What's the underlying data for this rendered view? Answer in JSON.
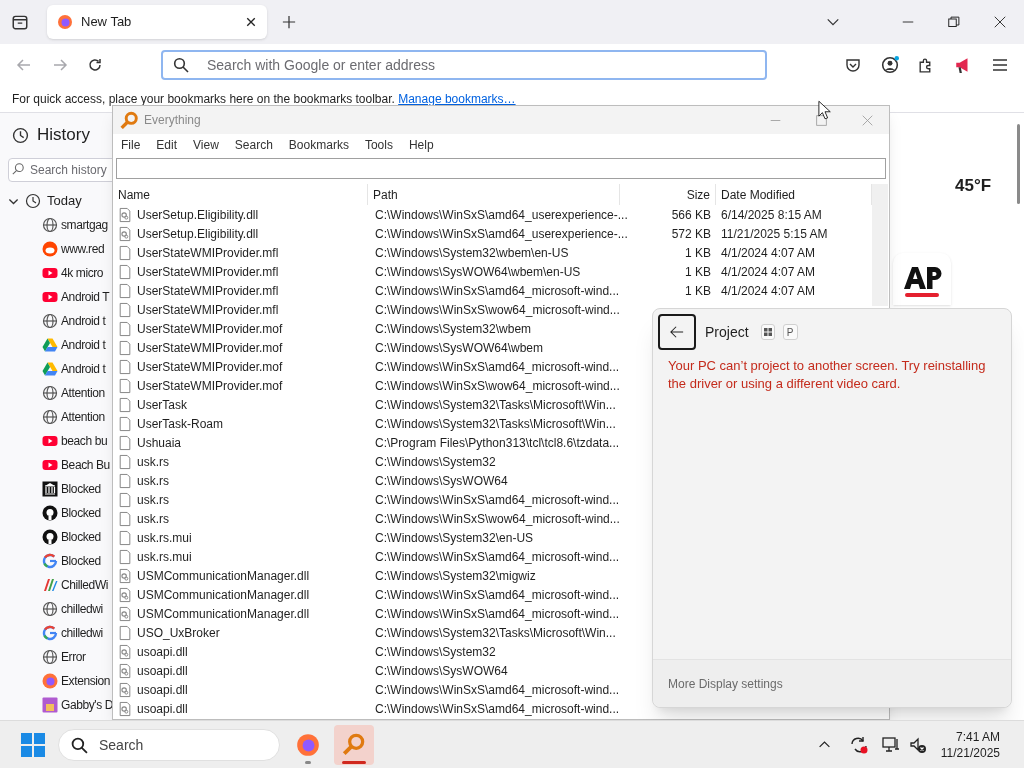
{
  "browser": {
    "tab": {
      "title": "New Tab",
      "selected": true
    },
    "back": {
      "disabled": true
    },
    "forward": {
      "disabled": true
    },
    "address_bar": {
      "placeholder": "Search with Google or enter address"
    },
    "bookmarks_bar": {
      "text": "For quick access, place your bookmarks here on the bookmarks toolbar.",
      "link": "Manage bookmarks…"
    }
  },
  "sidebar": {
    "title": "History",
    "search": {
      "placeholder": "Search history"
    },
    "groups": [
      {
        "label": "Today",
        "expanded": true,
        "children": [
          {
            "label": "smartgag",
            "kind": "globe"
          },
          {
            "label": "www.red",
            "kind": "reddit"
          },
          {
            "label": "4k micro",
            "kind": "youtube"
          },
          {
            "label": "Android T",
            "kind": "youtube"
          },
          {
            "label": "Android t",
            "kind": "globe"
          },
          {
            "label": "Android t",
            "kind": "drive"
          },
          {
            "label": "Android t",
            "kind": "drive"
          },
          {
            "label": "Attention",
            "kind": "globe"
          },
          {
            "label": "Attention",
            "kind": "globe"
          },
          {
            "label": "beach bu",
            "kind": "youtube"
          },
          {
            "label": "Beach Bu",
            "kind": "youtube"
          },
          {
            "label": "Blocked",
            "kind": "library"
          },
          {
            "label": "Blocked",
            "kind": "github"
          },
          {
            "label": "Blocked",
            "kind": "github"
          },
          {
            "label": "Blocked",
            "kind": "google"
          },
          {
            "label": "ChilledWi",
            "kind": "chilled"
          },
          {
            "label": "chilledwi",
            "kind": "globe"
          },
          {
            "label": "chilledwi",
            "kind": "google"
          },
          {
            "label": "Error",
            "kind": "globe"
          },
          {
            "label": "Extension",
            "kind": "firefox"
          },
          {
            "label": "Gabby's D",
            "kind": "square"
          }
        ]
      }
    ]
  },
  "new_tab": {
    "weather": "45°F"
  },
  "everything": {
    "title": "Everything",
    "menu": [
      "File",
      "Edit",
      "View",
      "Search",
      "Bookmarks",
      "Tools",
      "Help"
    ],
    "columns": [
      "Name",
      "Path",
      "Size",
      "Date Modified"
    ],
    "rows": [
      {
        "kind": "dll",
        "name": "UserSetup.Eligibility.dll",
        "path": "C:\\Windows\\WinSxS\\amd64_userexperience-...",
        "size": "566 KB",
        "date": "6/14/2025 8:15 AM"
      },
      {
        "kind": "dll",
        "name": "UserSetup.Eligibility.dll",
        "path": "C:\\Windows\\WinSxS\\amd64_userexperience-...",
        "size": "572 KB",
        "date": "11/21/2025 5:15 AM"
      },
      {
        "kind": "file",
        "name": "UserStateWMIProvider.mfl",
        "path": "C:\\Windows\\System32\\wbem\\en-US",
        "size": "1 KB",
        "date": "4/1/2024 4:07 AM"
      },
      {
        "kind": "file",
        "name": "UserStateWMIProvider.mfl",
        "path": "C:\\Windows\\SysWOW64\\wbem\\en-US",
        "size": "1 KB",
        "date": "4/1/2024 4:07 AM"
      },
      {
        "kind": "file",
        "name": "UserStateWMIProvider.mfl",
        "path": "C:\\Windows\\WinSxS\\amd64_microsoft-wind...",
        "size": "1 KB",
        "date": "4/1/2024 4:07 AM"
      },
      {
        "kind": "file",
        "name": "UserStateWMIProvider.mfl",
        "path": "C:\\Windows\\WinSxS\\wow64_microsoft-wind..."
      },
      {
        "kind": "file",
        "name": "UserStateWMIProvider.mof",
        "path": "C:\\Windows\\System32\\wbem"
      },
      {
        "kind": "file",
        "name": "UserStateWMIProvider.mof",
        "path": "C:\\Windows\\SysWOW64\\wbem"
      },
      {
        "kind": "file",
        "name": "UserStateWMIProvider.mof",
        "path": "C:\\Windows\\WinSxS\\amd64_microsoft-wind..."
      },
      {
        "kind": "file",
        "name": "UserStateWMIProvider.mof",
        "path": "C:\\Windows\\WinSxS\\wow64_microsoft-wind..."
      },
      {
        "kind": "file",
        "name": "UserTask",
        "path": "C:\\Windows\\System32\\Tasks\\Microsoft\\Win..."
      },
      {
        "kind": "file",
        "name": "UserTask-Roam",
        "path": "C:\\Windows\\System32\\Tasks\\Microsoft\\Win..."
      },
      {
        "kind": "file",
        "name": "Ushuaia",
        "path": "C:\\Program Files\\Python313\\tcl\\tcl8.6\\tzdata..."
      },
      {
        "kind": "file",
        "name": "usk.rs",
        "path": "C:\\Windows\\System32"
      },
      {
        "kind": "file",
        "name": "usk.rs",
        "path": "C:\\Windows\\SysWOW64"
      },
      {
        "kind": "file",
        "name": "usk.rs",
        "path": "C:\\Windows\\WinSxS\\amd64_microsoft-wind..."
      },
      {
        "kind": "file",
        "name": "usk.rs",
        "path": "C:\\Windows\\WinSxS\\wow64_microsoft-wind..."
      },
      {
        "kind": "file",
        "name": "usk.rs.mui",
        "path": "C:\\Windows\\System32\\en-US"
      },
      {
        "kind": "file",
        "name": "usk.rs.mui",
        "path": "C:\\Windows\\WinSxS\\amd64_microsoft-wind..."
      },
      {
        "kind": "dll",
        "name": "USMCommunicationManager.dll",
        "path": "C:\\Windows\\System32\\migwiz"
      },
      {
        "kind": "dll",
        "name": "USMCommunicationManager.dll",
        "path": "C:\\Windows\\WinSxS\\amd64_microsoft-wind..."
      },
      {
        "kind": "dll",
        "name": "USMCommunicationManager.dll",
        "path": "C:\\Windows\\WinSxS\\amd64_microsoft-wind..."
      },
      {
        "kind": "file",
        "name": "USO_UxBroker",
        "path": "C:\\Windows\\System32\\Tasks\\Microsoft\\Win..."
      },
      {
        "kind": "dll",
        "name": "usoapi.dll",
        "path": "C:\\Windows\\System32"
      },
      {
        "kind": "dll",
        "name": "usoapi.dll",
        "path": "C:\\Windows\\SysWOW64"
      },
      {
        "kind": "dll",
        "name": "usoapi.dll",
        "path": "C:\\Windows\\WinSxS\\amd64_microsoft-wind..."
      },
      {
        "kind": "dll",
        "name": "usoapi.dll",
        "path": "C:\\Windows\\WinSxS\\amd64_microsoft-wind..."
      }
    ]
  },
  "project_flyout": {
    "title": "Project",
    "shortcut_key": "P",
    "message": "Your PC can’t project to another screen. Try reinstalling the driver or using a different video card.",
    "footer_link": "More Display settings"
  },
  "taskbar": {
    "search": {
      "placeholder": "Search"
    },
    "apps": [
      {
        "kind": "firefox",
        "active": false
      },
      {
        "kind": "everything",
        "active": true
      }
    ],
    "time": "7:41 AM",
    "date": "11/21/2025"
  }
}
